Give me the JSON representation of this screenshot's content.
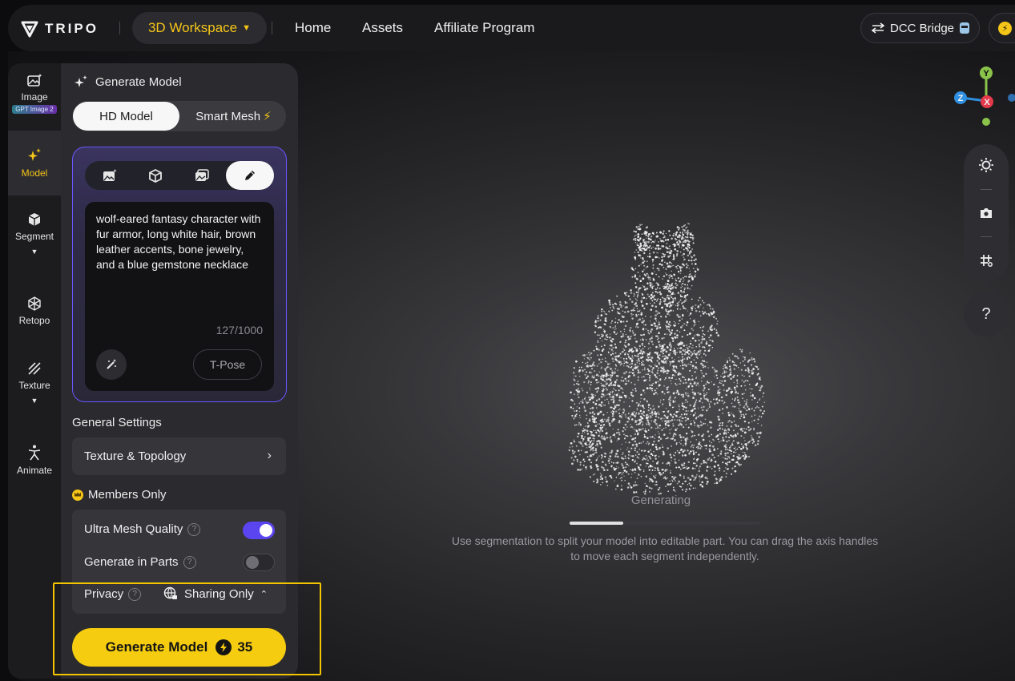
{
  "header": {
    "logo_text": "TRIPO",
    "workspace_label": "3D Workspace",
    "nav": [
      "Home",
      "Assets",
      "Affiliate Program"
    ],
    "dcc_label": "DCC Bridge"
  },
  "rail": {
    "items": [
      {
        "label": "Image",
        "badge": "GPT Image 2",
        "icon": "image-sparkle-icon"
      },
      {
        "label": "Model",
        "icon": "sparkle-icon",
        "active": true
      },
      {
        "label": "Segment",
        "icon": "cube-split-icon",
        "expandable": true
      },
      {
        "label": "Retopo",
        "icon": "mesh-icon"
      },
      {
        "label": "Texture",
        "icon": "texture-icon",
        "expandable": true
      },
      {
        "label": "Animate",
        "icon": "figure-icon"
      }
    ]
  },
  "panel": {
    "title": "Generate Model",
    "modes": {
      "hd": "HD Model",
      "smart": "Smart Mesh"
    },
    "input_tabs": [
      "image-input-icon",
      "cube-input-icon",
      "multi-image-icon",
      "pencil-icon"
    ],
    "prompt_text": "wolf-eared fantasy character with fur armor, long white hair, brown leather accents, bone jewelry, and a blue gemstone necklace",
    "counter": "127/1000",
    "tpose_label": "T-Pose",
    "general_settings_label": "General Settings",
    "texture_topology_label": "Texture & Topology",
    "members_label": "Members Only",
    "ultra_mesh_label": "Ultra Mesh Quality",
    "ultra_mesh_on": true,
    "parts_label": "Generate in Parts",
    "parts_on": false,
    "privacy_label": "Privacy",
    "privacy_value": "Sharing Only",
    "generate_label": "Generate Model",
    "generate_cost": "35"
  },
  "viewport": {
    "status": "Generating",
    "progress": 0.28,
    "hint": "Use segmentation to split your model into editable part. You can drag the axis handles to move each segment independently.",
    "axes": {
      "y": "Y",
      "x": "X",
      "z": "Z"
    }
  },
  "colors": {
    "accent": "#f5c518",
    "purple": "#5b45f0",
    "axis_y": "#8bc34a",
    "axis_x": "#e5394a",
    "axis_z": "#2f8fe0"
  }
}
